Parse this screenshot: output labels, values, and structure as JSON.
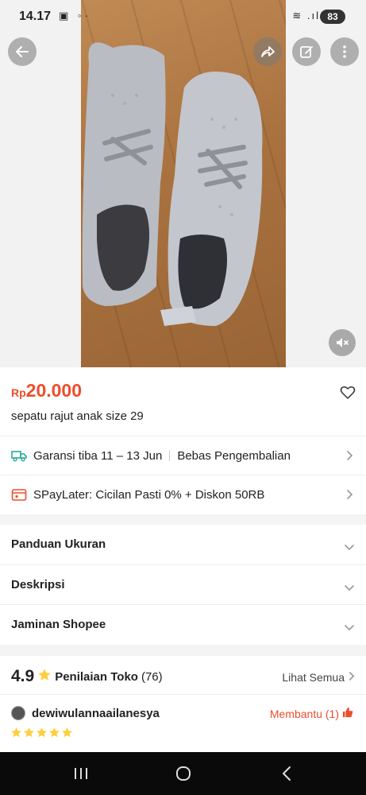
{
  "status_bar": {
    "time": "14.17",
    "left_icons": "▣ ◦·",
    "right_icons": "≋ .ıl",
    "battery": "83"
  },
  "toolbar": {
    "back_icon": "arrow-left-icon",
    "share_icon": "share-icon",
    "edit_icon": "edit-icon",
    "more_icon": "more-vertical-icon"
  },
  "media": {
    "mute_icon": "volume-mute-icon"
  },
  "product": {
    "currency": "Rp",
    "price": "20.000",
    "title": "sepatu rajut anak size 29",
    "accent_color": "#ee4d2d"
  },
  "shipping": {
    "guarantee": "Garansi tiba 11 – 13 Jun",
    "returns": "Bebas Pengembalian"
  },
  "payment": {
    "text": "SPayLater: Cicilan Pasti 0% + Diskon 50RB"
  },
  "accordion": [
    {
      "label": "Panduan Ukuran"
    },
    {
      "label": "Deskripsi"
    },
    {
      "label": "Jaminan Shopee"
    }
  ],
  "reviews": {
    "score": "4.9",
    "label": "Penilaian Toko",
    "count": "(76)",
    "see_all": "Lihat Semua",
    "first": {
      "username": "dewiwulannaailanesya",
      "helpful": "Membantu (1)",
      "stars": 5
    }
  }
}
